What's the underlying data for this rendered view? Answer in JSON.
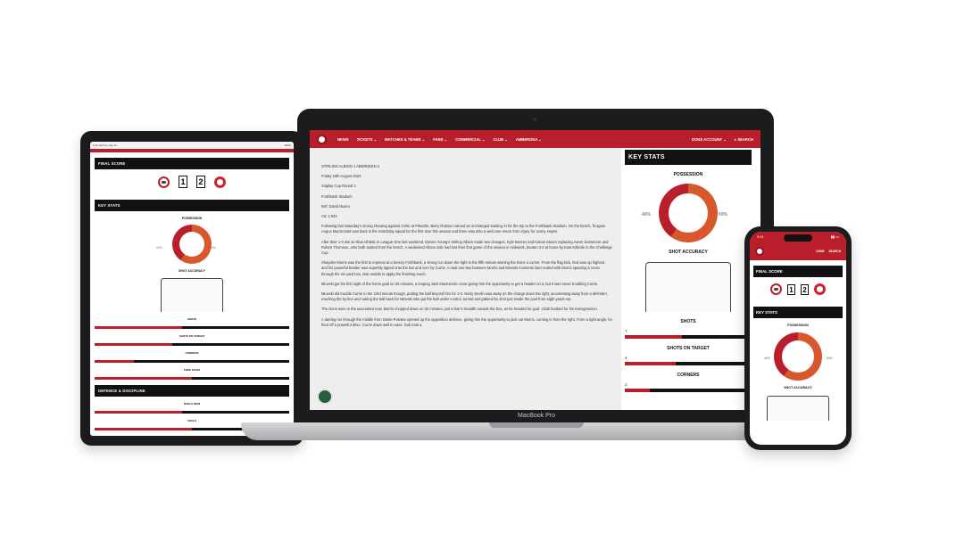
{
  "tablet": {
    "status_left": "9:41 AM   Tue Sep 12",
    "status_right": "100%",
    "final_score_heading": "FINAL SCORE",
    "home_score": "1",
    "away_score": "2",
    "key_stats_heading": "KEY STATS",
    "possession_label": "POSSESSION",
    "possession_home": "40%",
    "possession_away": "60%",
    "shot_accuracy_label": "SHOT ACCURACY",
    "bars": [
      {
        "label": "SHOTS",
        "fill": 0.45
      },
      {
        "label": "SHOTS ON TARGET",
        "fill": 0.4
      },
      {
        "label": "CORNERS",
        "fill": 0.2
      },
      {
        "label": "FREE KICKS",
        "fill": 0.5
      }
    ],
    "discipline_heading": "DEFENCE & DISCIPLINE",
    "discipline_bars": [
      {
        "label": "DUELS WON",
        "fill": 0.45
      },
      {
        "label": "FOULS",
        "fill": 0.5
      },
      {
        "label": "YELLOW CARDS",
        "fill": 0.5
      }
    ]
  },
  "laptop": {
    "brand_label": "MacBook Pro",
    "nav": {
      "items": [
        "NEWS",
        "TICKETS ⌄",
        "MATCHES & TEAMS ⌄",
        "FANS ⌄",
        "COMMERCIAL ⌄",
        "CLUB ⌄",
        "AMBERDNA ⌄"
      ],
      "account": "DONS ACCOUNT ⌄",
      "search": "SEARCH"
    },
    "article": [
      "STIRLING ALBION 1 ABERDEEN 2",
      "Friday 18th August 2023",
      "Viaplay Cup Round 2",
      "Forthbank Stadium",
      "Ref: David Munro",
      "Att: 2,943",
      "Following last Saturday's strong showing against Celtic at Pittodrie, Barry Robson named an unchanged starting XI for the trip to the Forthbank Stadium. On the bench, fit again Angus MacDonald was back in the matchday squad for the first time this season and there was also a welcome return from injury for Jonny Hayes.",
      "After their 1-0 win at Alloa Athletic in League One last weekend, Darren Young's Stirling Albion made two changes, Kyle Benner and Kieran Moore replacing Aaron Dunsmore and Robert Thomson, who both started from the bench. A weakened Albion side had lost their first game of the season in midweek, beaten 3-0 at home by East Kilbride in the Challenge Cup.",
      "Shayden Morris was the first to impress at a breezy Forthbank, a strong run down the right in the fifth minute winning the Dons a corner. From the flag kick, Duk was up highest, and his powerful header was superbly tipped onto the bar and over by Currie. A neat one-two between Morris and Miovski moments later ended with Morris spearing a cross through the six-yard box, Duk unable to apply the finishing touch.",
      "Miovski got his first sight of the home goal on 20 minutes, a looping Jack MacKenzie cross giving him the opportunity to get a header on it, but it was never troubling Currie.",
      "Miovski did trouble Currie in the 23rd minute though, putting the ball beyond him for 1-0. Nicky Devlin was away on the charge down the right, accelerating away from a defender, reaching the by-line and cutting the ball back for Miovski who got the ball under control, turned and jabbed his shot just inside the post from eight yards out.",
      "The Dons were in the ascendant now, Morris chopped down on 32 minutes, just a hair's breadth outside the box, as he headed for goal. Clark booked for his transgression.",
      "A darting run through the middle from Dante Polvara opened up the opposition defence, giving him the opportunity to pick out Morris, coming in from the right. From a tight angle, he fired off a powerful drive, Currie down well to save. Duk took a"
    ],
    "side": {
      "heading": "KEY STATS",
      "possession_label": "POSSESSION",
      "possession_home": "40%",
      "possession_away": "60%",
      "shot_accuracy_label": "SHOT ACCURACY",
      "stats": [
        {
          "label": "SHOTS",
          "value": "7",
          "fill": 0.45
        },
        {
          "label": "SHOTS ON TARGET",
          "value": "4",
          "fill": 0.4
        },
        {
          "label": "CORNERS",
          "value": "2",
          "fill": 0.2
        }
      ]
    }
  },
  "phone": {
    "time": "9:41",
    "nav_account": "DONS",
    "nav_search": "SEARCH",
    "final_score_heading": "FINAL SCORE",
    "home_score": "1",
    "away_score": "2",
    "key_stats_heading": "KEY STATS",
    "possession_label": "POSSESSION",
    "possession_home": "40%",
    "possession_away": "60%",
    "shot_accuracy_label": "SHOT ACCURACY"
  },
  "colors": {
    "brand_red": "#b81f2b",
    "away_orange": "#d9582b",
    "heading_black": "#111111"
  }
}
